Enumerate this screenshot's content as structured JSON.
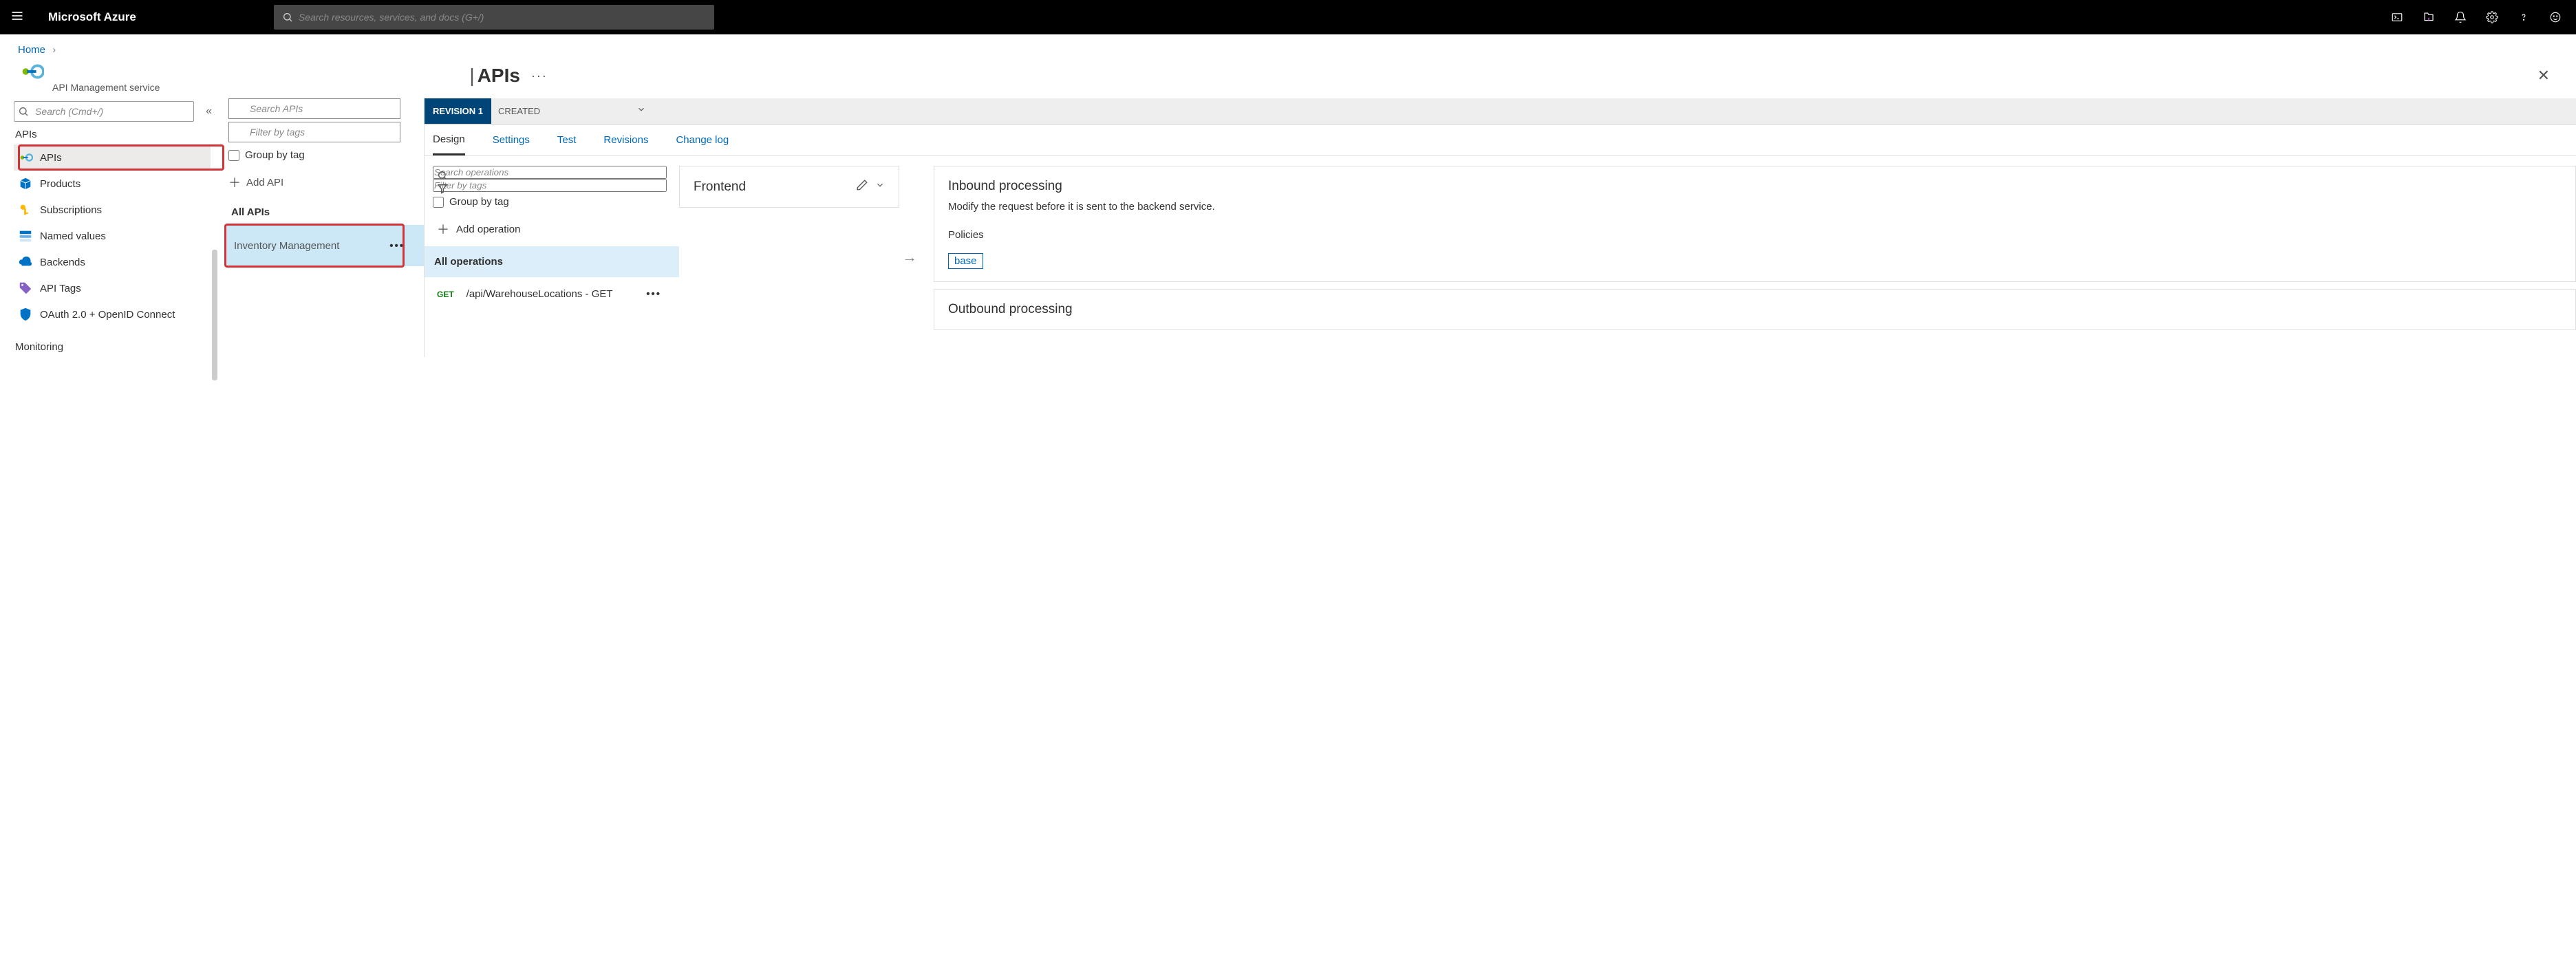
{
  "brand": "Microsoft Azure",
  "globalSearch": {
    "placeholder": "Search resources, services, and docs (G+/)"
  },
  "breadcrumb": {
    "home": "Home"
  },
  "service": {
    "subtitle": "API Management service"
  },
  "pageTitle": "APIs",
  "leftnav": {
    "searchPlaceholder": "Search (Cmd+/)",
    "sectionApis": "APIs",
    "items": {
      "apis": "APIs",
      "products": "Products",
      "subscriptions": "Subscriptions",
      "namedValues": "Named values",
      "backends": "Backends",
      "apiTags": "API Tags",
      "oauth": "OAuth 2.0 + OpenID Connect"
    },
    "sectionMonitoring": "Monitoring"
  },
  "apisCol": {
    "searchPlaceholder": "Search APIs",
    "filterPlaceholder": "Filter by tags",
    "groupByTag": "Group by tag",
    "addApi": "Add API",
    "allApis": "All APIs",
    "selectedApi": "Inventory Management"
  },
  "revision": {
    "label": "REVISION 1",
    "created": "CREATED"
  },
  "tabs": {
    "design": "Design",
    "settings": "Settings",
    "test": "Test",
    "revisions": "Revisions",
    "changelog": "Change log"
  },
  "ops": {
    "searchPlaceholder": "Search operations",
    "filterPlaceholder": "Filter by tags",
    "groupByTag": "Group by tag",
    "addOperation": "Add operation",
    "allOperations": "All operations",
    "op1": {
      "verb": "GET",
      "name": "/api/WarehouseLocations - GET"
    }
  },
  "frontend": {
    "title": "Frontend"
  },
  "inbound": {
    "title": "Inbound processing",
    "desc": "Modify the request before it is sent to the backend service.",
    "policies": "Policies",
    "base": "base"
  },
  "outbound": {
    "title": "Outbound processing"
  }
}
